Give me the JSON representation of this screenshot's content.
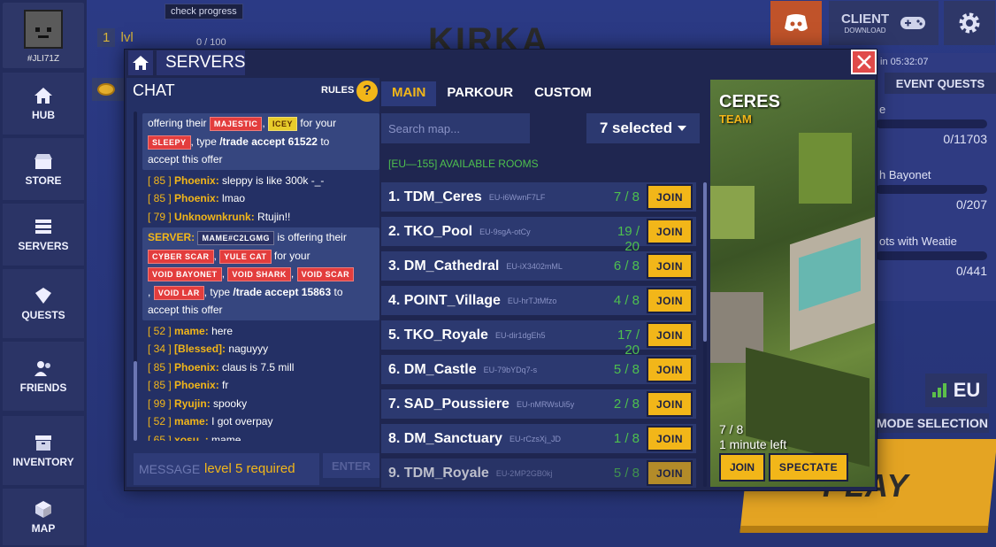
{
  "profile": {
    "tag": "#JLI71Z",
    "level": "1",
    "level_suffix": "lvl",
    "xp": "0 / 100",
    "check_progress": "check progress"
  },
  "nav": [
    {
      "label": "HUB",
      "icon": "home-icon"
    },
    {
      "label": "STORE",
      "icon": "store-icon"
    },
    {
      "label": "SERVERS",
      "icon": "servers-icon"
    },
    {
      "label": "QUESTS",
      "icon": "quests-icon"
    },
    {
      "label": "FRIENDS",
      "icon": "friends-icon"
    },
    {
      "label": "INVENTORY",
      "icon": "inventory-icon"
    },
    {
      "label": "MAP",
      "icon": "map-icon"
    }
  ],
  "topbar": {
    "logo": "KIRKA",
    "client_label": "CLIENT",
    "client_sub": "DOWNLOAD"
  },
  "right_panel": {
    "timer": "in 05:32:07",
    "event_quests": "EVENT QUESTS",
    "quests": [
      {
        "title": "e",
        "value": "0/11703"
      },
      {
        "title": "h Bayonet",
        "value": "0/207"
      },
      {
        "title": "ots with Weatie",
        "value": "0/441"
      }
    ],
    "region": "EU",
    "mode_selection": "MODE SELECTION",
    "play": "PLAY"
  },
  "modal": {
    "title": "SERVERS",
    "chat": {
      "title": "CHAT",
      "rules": "RULES",
      "rules_icon": "?",
      "input_placeholder": "MESSAGE",
      "input_requirement": "level 5 required",
      "enter": "ENTER",
      "server1": {
        "prefix": "offering their",
        "tag1": "MAJESTIC",
        "sep": ",",
        "tag2": "ICEY",
        "for": "for your",
        "tag3": "SLEEPY",
        "type": ", type",
        "cmd": "/trade accept 61522",
        "to": "to",
        "tail": "accept this offer"
      },
      "lines_a": [
        {
          "level": "[ 85 ]",
          "name": "Phoenix:",
          "msg": "sleppy is like 300k -_-"
        },
        {
          "level": "[ 85 ]",
          "name": "Phoenix:",
          "msg": "lmao"
        },
        {
          "level": "[ 79 ]",
          "name": "Unknownkrunk:",
          "msg": "Rtujin!!"
        }
      ],
      "server2": {
        "label": "SERVER:",
        "user": "MAME#C2LGMG",
        "offering": "is offering their",
        "t1": "CYBER SCAR",
        "t2": "YULE CAT",
        "for": "for your",
        "t3": "VOID BAYONET",
        "t4": "VOID SHARK",
        "t5": "VOID SCAR",
        "t6": "VOID LAR",
        "comma": ",",
        "type": ", type",
        "cmd": "/trade accept 15863",
        "to": "to",
        "tail": "accept this offer"
      },
      "lines_b": [
        {
          "level": "[ 52 ]",
          "name": "mame:",
          "msg": "here"
        },
        {
          "level": "[ 34 ]",
          "name": "[Blessed]:",
          "msg": "naguyyy"
        },
        {
          "level": "[ 85 ]",
          "name": "Phoenix:",
          "msg": "claus is 7.5 mill"
        },
        {
          "level": "[ 85 ]",
          "name": "Phoenix:",
          "msg": "fr"
        },
        {
          "level": "[ 99 ]",
          "name": "Ryujin:",
          "msg": "spooky"
        },
        {
          "level": "[ 52 ]",
          "name": "mame:",
          "msg": "I got overpay"
        },
        {
          "level": "[ 65 ]",
          "name": "xosu..:",
          "msg": "mame"
        }
      ]
    },
    "servers": {
      "tabs": [
        "MAIN",
        "PARKOUR",
        "CUSTOM"
      ],
      "search_placeholder": "Search map...",
      "filter": "7 selected",
      "rooms_heading": "[EU—155] AVAILABLE ROOMS",
      "join_label": "JOIN",
      "rooms": [
        {
          "name": "1. TDM_Ceres",
          "id": "EU-i6WwnF7LF",
          "count": "7 / 8"
        },
        {
          "name": "2. TKO_Pool",
          "id": "EU-9sgA-otCy",
          "count": "19 / 20"
        },
        {
          "name": "3. DM_Cathedral",
          "id": "EU-iX3402mML",
          "count": "6 / 8"
        },
        {
          "name": "4. POINT_Village",
          "id": "EU-hrTJtMfzo",
          "count": "4 / 8"
        },
        {
          "name": "5. TKO_Royale",
          "id": "EU-dir1dgEh5",
          "count": "17 / 20"
        },
        {
          "name": "6. DM_Castle",
          "id": "EU-79bYDq7-s",
          "count": "5 / 8"
        },
        {
          "name": "7. SAD_Poussiere",
          "id": "EU-nMRWsUi5y",
          "count": "2 / 8"
        },
        {
          "name": "8. DM_Sanctuary",
          "id": "EU-rCzsXj_JD",
          "count": "1 / 8"
        },
        {
          "name": "9. TDM_Royale",
          "id": "EU-2MP2GB0kj",
          "count": "5 / 8"
        }
      ]
    },
    "preview": {
      "map": "CERES",
      "mode": "TEAM",
      "count": "7 / 8",
      "time_left": "1 minute left",
      "join": "JOIN",
      "spectate": "SPECTATE"
    }
  },
  "colors": {
    "accent": "#f2b619",
    "success": "#4ec04e",
    "danger": "#e04a4a",
    "modal_bg": "#1f2650"
  }
}
